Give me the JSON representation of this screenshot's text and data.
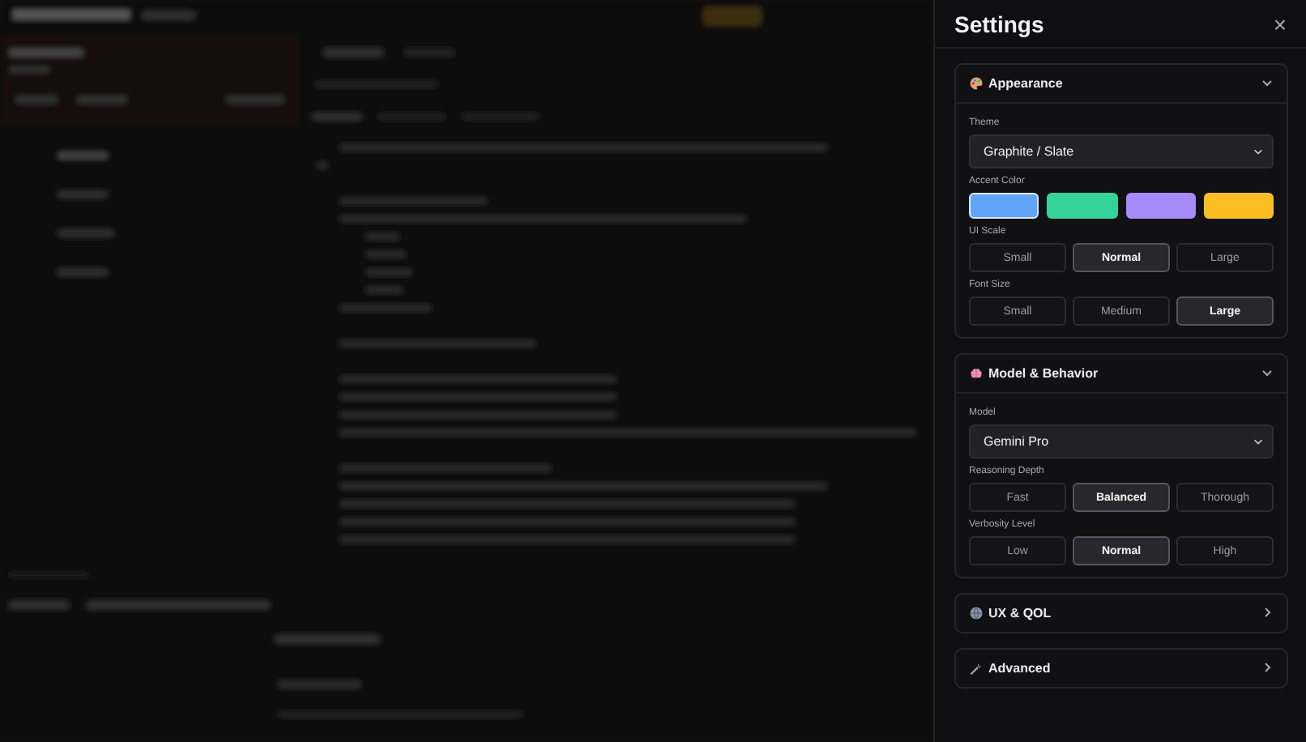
{
  "panel": {
    "title": "Settings",
    "close": "×"
  },
  "sections": [
    {
      "kind": "palette",
      "title": "Appearance",
      "expanded": true,
      "fields": [
        {
          "kind": "select",
          "label": "Theme",
          "value": "Graphite / Slate"
        },
        {
          "kind": "swatches",
          "label": "Accent Color",
          "swatches": [
            {
              "color": "#60a5fa",
              "selected": true
            },
            {
              "color": "#34d399",
              "selected": false
            },
            {
              "color": "#a78bfa",
              "selected": false
            },
            {
              "color": "#fbbf24",
              "selected": false
            }
          ]
        },
        {
          "kind": "segmented",
          "label": "UI Scale",
          "options": [
            {
              "label": "Small",
              "selected": false
            },
            {
              "label": "Normal",
              "selected": true
            },
            {
              "label": "Large",
              "selected": false
            }
          ]
        },
        {
          "kind": "segmented",
          "label": "Font Size",
          "options": [
            {
              "label": "Small",
              "selected": false
            },
            {
              "label": "Medium",
              "selected": false
            },
            {
              "label": "Large",
              "selected": true
            }
          ]
        }
      ]
    },
    {
      "kind": "brain",
      "title": "Model & Behavior",
      "expanded": true,
      "fields": [
        {
          "kind": "select",
          "label": "Model",
          "value": "Gemini Pro"
        },
        {
          "kind": "segmented",
          "label": "Reasoning Depth",
          "options": [
            {
              "label": "Fast",
              "selected": false
            },
            {
              "label": "Balanced",
              "selected": true
            },
            {
              "label": "Thorough",
              "selected": false
            }
          ]
        },
        {
          "kind": "segmented",
          "label": "Verbosity Level",
          "options": [
            {
              "label": "Low",
              "selected": false
            },
            {
              "label": "Normal",
              "selected": true
            },
            {
              "label": "High",
              "selected": false
            }
          ]
        }
      ]
    },
    {
      "kind": "globe",
      "title": "UX & QOL",
      "expanded": false
    },
    {
      "kind": "wrench",
      "title": "Advanced",
      "expanded": false
    }
  ]
}
